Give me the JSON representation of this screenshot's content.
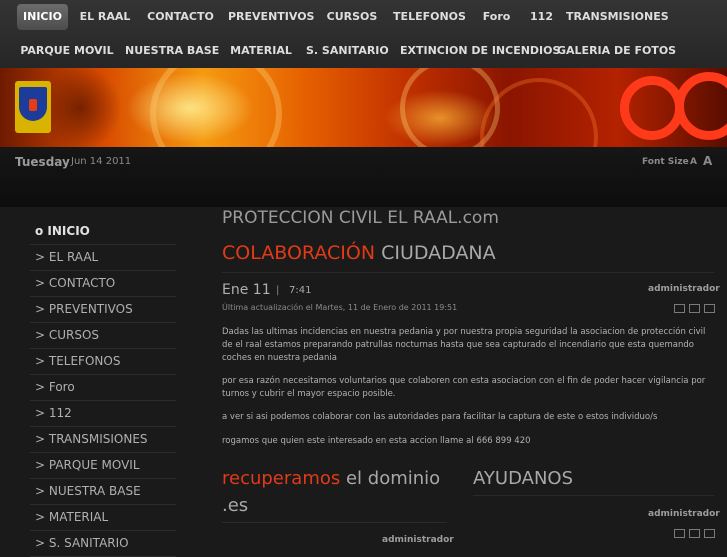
{
  "nav": {
    "row1": [
      {
        "label": "INICIO",
        "active": true
      },
      {
        "label": "EL RAAL"
      },
      {
        "label": "CONTACTO"
      },
      {
        "label": "PREVENTIVOS"
      },
      {
        "label": "CURSOS"
      },
      {
        "label": "TELEFONOS"
      },
      {
        "label": "Foro"
      },
      {
        "label": "112"
      },
      {
        "label": "TRANSMISIONES"
      }
    ],
    "row2": [
      {
        "label": "PARQUE MOVIL"
      },
      {
        "label": "NUESTRA BASE"
      },
      {
        "label": "MATERIAL"
      },
      {
        "label": "S. SANITARIO"
      },
      {
        "label": "EXTINCION DE INCENDIOS"
      },
      {
        "label": "GALERIA DE FOTOS"
      }
    ]
  },
  "datebar": {
    "day": "Tuesday",
    "date": "Jun 14 2011",
    "font_size_label": "Font Size",
    "font_small": "A",
    "font_big": "A"
  },
  "sidebar": {
    "items": [
      {
        "label": "o INICIO",
        "active": true
      },
      {
        "label": "> EL RAAL"
      },
      {
        "label": "> CONTACTO"
      },
      {
        "label": "> PREVENTIVOS"
      },
      {
        "label": "> CURSOS"
      },
      {
        "label": "> TELEFONOS"
      },
      {
        "label": "> Foro"
      },
      {
        "label": "> 112"
      },
      {
        "label": "> TRANSMISIONES"
      },
      {
        "label": "> PARQUE MOVIL"
      },
      {
        "label": "> NUESTRA BASE"
      },
      {
        "label": "> MATERIAL"
      },
      {
        "label": "> S. SANITARIO"
      }
    ]
  },
  "main": {
    "site_title": "PROTECCION CIVIL EL RAAL.com",
    "article": {
      "title_highlight": "COLABORACIÓN",
      "title_rest": " CIUDADANA",
      "date": "Ene 11",
      "separator": "|",
      "time": "7:41",
      "author": "administrador",
      "updated": "Última actualización el Martes, 11 de Enero de 2011 19:51",
      "paragraphs": [
        "Dadas las ultimas incidencias en nuestra pedania y por nuestra propia seguridad la asociacion de protección civil de el raal estamos preparando patrullas nocturnas hasta que sea capturado el incendiario que esta quemando coches en nuestra pedania",
        "por esa razón necesitamos voluntarios que colaboren con esta asociacion con el fin de poder hacer vigilancia por turnos y cubrir el mayor espacio posible.",
        "a ver si asi podemos colaborar con las autoridades para facilitar la captura de este o estos individuo/s",
        "rogamos que quien este interesado en esta accion llame al 666 899 420"
      ]
    },
    "col1": {
      "title_highlight": "recuperamos",
      "title_rest": " el dominio .es",
      "author": "administrador"
    },
    "col2": {
      "title": "AYUDANOS",
      "author": "administrador"
    }
  },
  "colors": {
    "accent": "#e23a16",
    "background": "#1a1a1a",
    "nav_bg": "#2e2e2e"
  },
  "icons": [
    "shield-logo",
    "pdf-icon",
    "print-icon",
    "email-icon"
  ]
}
